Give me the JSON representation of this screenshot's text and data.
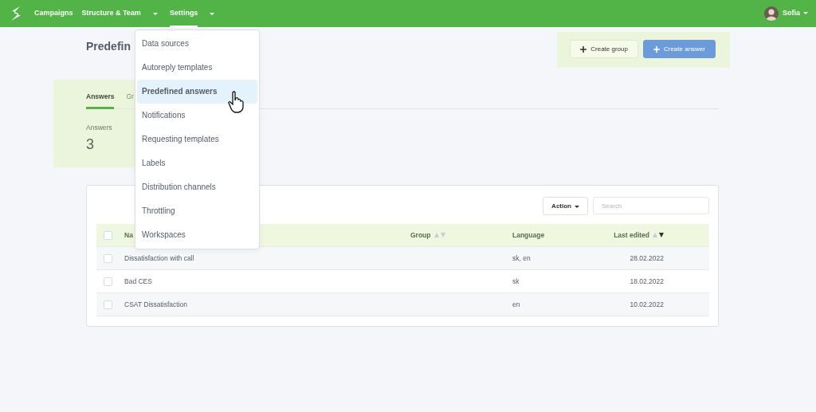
{
  "nav": {
    "items": [
      {
        "label": "Campaigns",
        "dropdown": false,
        "selected": false
      },
      {
        "label": "Structure & Team",
        "dropdown": true,
        "selected": false
      },
      {
        "label": "Settings",
        "dropdown": true,
        "selected": true
      }
    ],
    "user": {
      "name": "Sofia"
    }
  },
  "page": {
    "title": "Predefin"
  },
  "buttons": [
    {
      "label": "Create group",
      "kind": "secondary"
    },
    {
      "label": "Create answer",
      "kind": "primary"
    }
  ],
  "tabs": [
    {
      "label": "Answers",
      "selected": true
    },
    {
      "label": "Gr",
      "selected": false
    }
  ],
  "stat": {
    "label": "Answers",
    "value": "3"
  },
  "toolbar": {
    "action": "Action",
    "search_placeholder": "Search"
  },
  "table": {
    "columns": [
      {
        "label": "Na"
      },
      {
        "label": "Group",
        "sorted_desc": false
      },
      {
        "label": "Language"
      },
      {
        "label": "Last edited",
        "sorted_desc": true
      }
    ],
    "header_checked": false,
    "rows": [
      {
        "checked": false,
        "cells": [
          "Dissatisfaction with call",
          "",
          "sk, en",
          "28.02.2022"
        ]
      },
      {
        "checked": false,
        "cells": [
          "Bad CES",
          "",
          "sk",
          "18.02.2022"
        ]
      },
      {
        "checked": false,
        "cells": [
          "CSAT Dissatisfaction",
          "",
          "en",
          "10.02.2022"
        ]
      }
    ]
  },
  "menu": {
    "items": [
      {
        "label": "Data sources",
        "selected": false
      },
      {
        "label": "Autoreply templates",
        "selected": false
      },
      {
        "label": "Predefined answers",
        "selected": true
      },
      {
        "label": "Notifications",
        "selected": false
      },
      {
        "label": "Requesting templates",
        "selected": false
      },
      {
        "label": "Labels",
        "selected": false
      },
      {
        "label": "Distribution channels",
        "selected": false
      },
      {
        "label": "Throttling",
        "selected": false
      },
      {
        "label": "Workspaces",
        "selected": false
      }
    ]
  }
}
